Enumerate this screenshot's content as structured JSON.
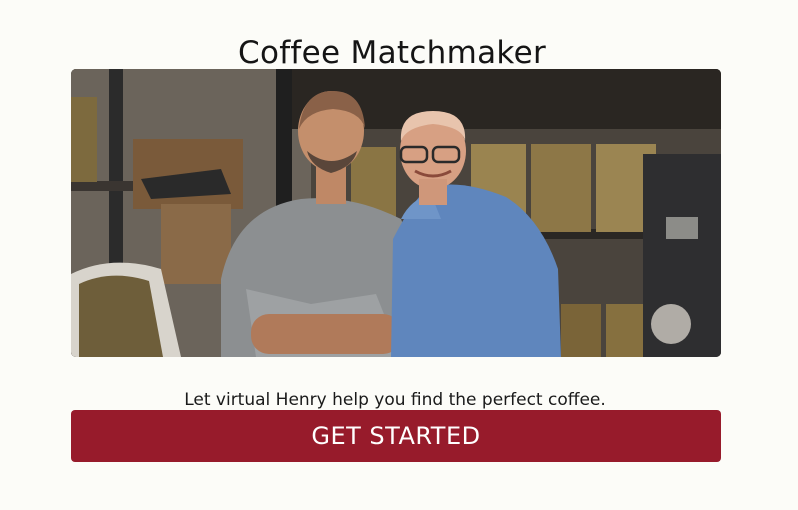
{
  "page": {
    "title": "Coffee Matchmaker",
    "subtitle": "Let virtual Henry help you find the perfect coffee.",
    "cta_label": "GET STARTED"
  },
  "colors": {
    "background": "#fcfcf8",
    "button": "#971b2b",
    "button_text": "#ffffff"
  }
}
